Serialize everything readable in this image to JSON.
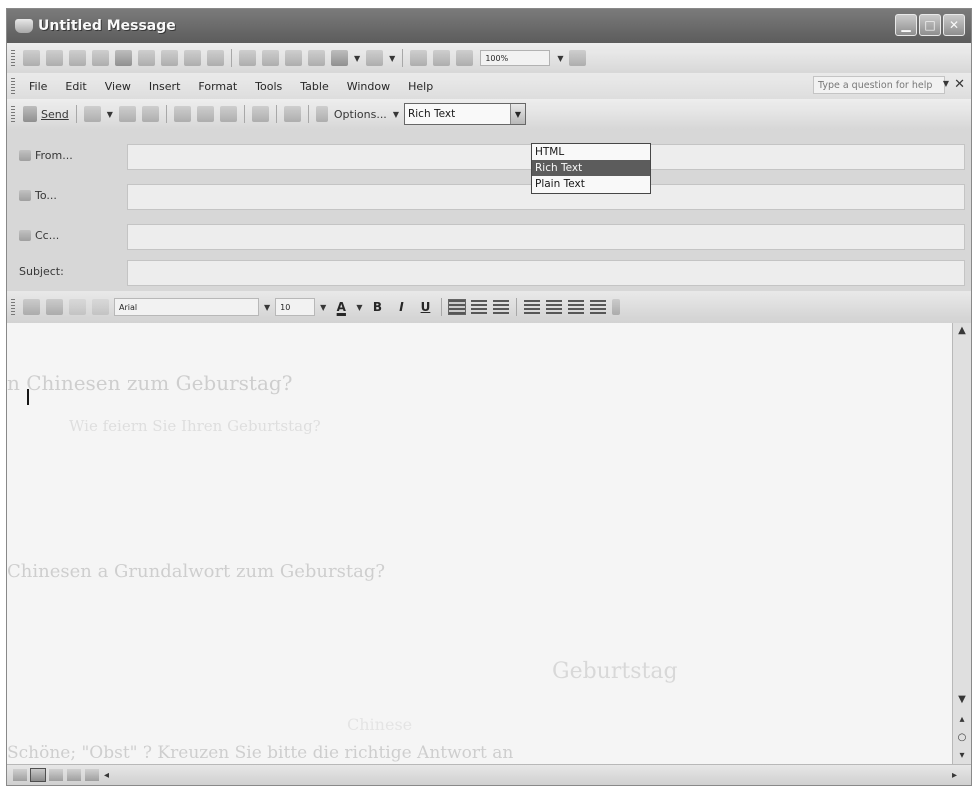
{
  "window": {
    "title": "Untitled Message"
  },
  "standard_toolbar": {
    "zoom": "100%"
  },
  "menu": {
    "items": [
      "File",
      "Edit",
      "View",
      "Insert",
      "Format",
      "Tools",
      "Table",
      "Window",
      "Help"
    ],
    "help_placeholder": "Type a question for help"
  },
  "email_toolbar": {
    "send_label": "Send",
    "options_label": "Options...",
    "format_value": "Rich Text",
    "format_options": [
      "HTML",
      "Rich Text",
      "Plain Text"
    ],
    "format_selected_index": 1
  },
  "header": {
    "from_label": "From...",
    "to_label": "To...",
    "cc_label": "Cc...",
    "subject_label": "Subject:"
  },
  "formatting_toolbar": {
    "font": "Arial",
    "size": "10"
  },
  "body_bleed_through": [
    "n Chinesen zum Geburstag?",
    "Wie feiern Sie Ihren Geburtstag?",
    "Chinesen a Grundalwort zum Geburstag?",
    "Geburtstag",
    "Chinese",
    "Schöne; \"Obst\" ? Kreuzen Sie bitte die richtige Antwort an"
  ]
}
